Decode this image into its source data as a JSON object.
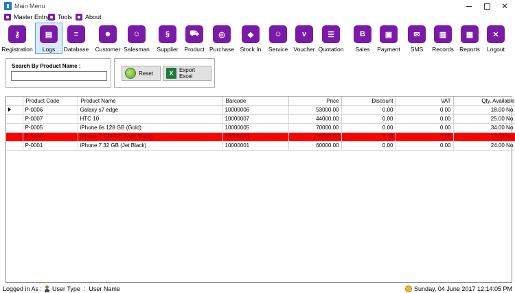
{
  "window": {
    "title": "Main Menu"
  },
  "menubar": [
    {
      "label": "Master Entry"
    },
    {
      "label": "Tools"
    },
    {
      "label": "About"
    }
  ],
  "toolbar": [
    {
      "label": "Registration",
      "icon": "key-icon",
      "glyph": "⚷"
    },
    {
      "label": "Logs",
      "icon": "id-card-icon",
      "glyph": "▤"
    },
    {
      "label": "Database",
      "icon": "database-icon",
      "glyph": "≡"
    },
    {
      "label": "Customer",
      "icon": "users-icon",
      "glyph": "☻"
    },
    {
      "label": "Salesman",
      "icon": "person-icon",
      "glyph": "☺"
    },
    {
      "label": "Supplier",
      "icon": "supplier-icon",
      "glyph": "§"
    },
    {
      "label": "Product",
      "icon": "cart-icon",
      "glyph": "⛟"
    },
    {
      "label": "Purchase",
      "icon": "tag-circle-icon",
      "glyph": "◎"
    },
    {
      "label": "Stock In",
      "icon": "tag-icon",
      "glyph": "◆"
    },
    {
      "label": "Service",
      "icon": "smiley-icon",
      "glyph": "☺"
    },
    {
      "label": "Voucher",
      "icon": "voucher-icon",
      "glyph": "v"
    },
    {
      "label": "Quotation",
      "icon": "document-icon",
      "glyph": "☰"
    },
    {
      "label": "Sales",
      "icon": "bold-b-icon",
      "glyph": "B"
    },
    {
      "label": "Payment",
      "icon": "briefcase-icon",
      "glyph": "▣"
    },
    {
      "label": "SMS",
      "icon": "envelope-icon",
      "glyph": "✉"
    },
    {
      "label": "Records",
      "icon": "book-icon",
      "glyph": "▥"
    },
    {
      "label": "Reports",
      "icon": "report-icon",
      "glyph": "▦"
    },
    {
      "label": "Logout",
      "icon": "close-icon",
      "glyph": "✕"
    }
  ],
  "search": {
    "label": "Search By Product Name :",
    "value": ""
  },
  "actions": {
    "reset_label": "Reset",
    "export_label": "Export Excel"
  },
  "grid": {
    "columns": [
      "Product Code",
      "Product Name",
      "Barcode",
      "Price",
      "Discount",
      "VAT",
      "Qty. Available"
    ],
    "rows": [
      [
        "P-0006",
        "Galaxy s7 edge",
        "10000006",
        "53000.00",
        "0.00",
        "0.00",
        "18.00 No."
      ],
      [
        "P-0007",
        "HTC 10",
        "10000007",
        "44000.00",
        "0.00",
        "0.00",
        "25.00 No."
      ],
      [
        "P-0005",
        "iPhone 6s 128 GB (Gold)",
        "10000005",
        "70000.00",
        "0.00",
        "0.00",
        "34.00 No."
      ],
      [
        "P-0004",
        "iPhone 7 128 GB (Matt Black)",
        "10000004",
        "70000.00",
        "0.00",
        "0.00",
        "13.00 No."
      ],
      [
        "P-0001",
        "iPhone 7 32 GB (Jet Black)",
        "10000001",
        "60000.00",
        "0.00",
        "0.00",
        "24.00 No."
      ]
    ],
    "selected_row": 3,
    "current_row": 0,
    "highlight_color": "#ff0000"
  },
  "status": {
    "logged_in_label": "Logged in As :",
    "user_type_label": "User Type",
    "separator": ":",
    "user_name_label": "User Name",
    "datetime": "Sunday, 04 June 2017 12:14:05 PM"
  },
  "colors": {
    "accent": "#7a1aa8",
    "active_tool_bg": "#d9ebfb"
  }
}
